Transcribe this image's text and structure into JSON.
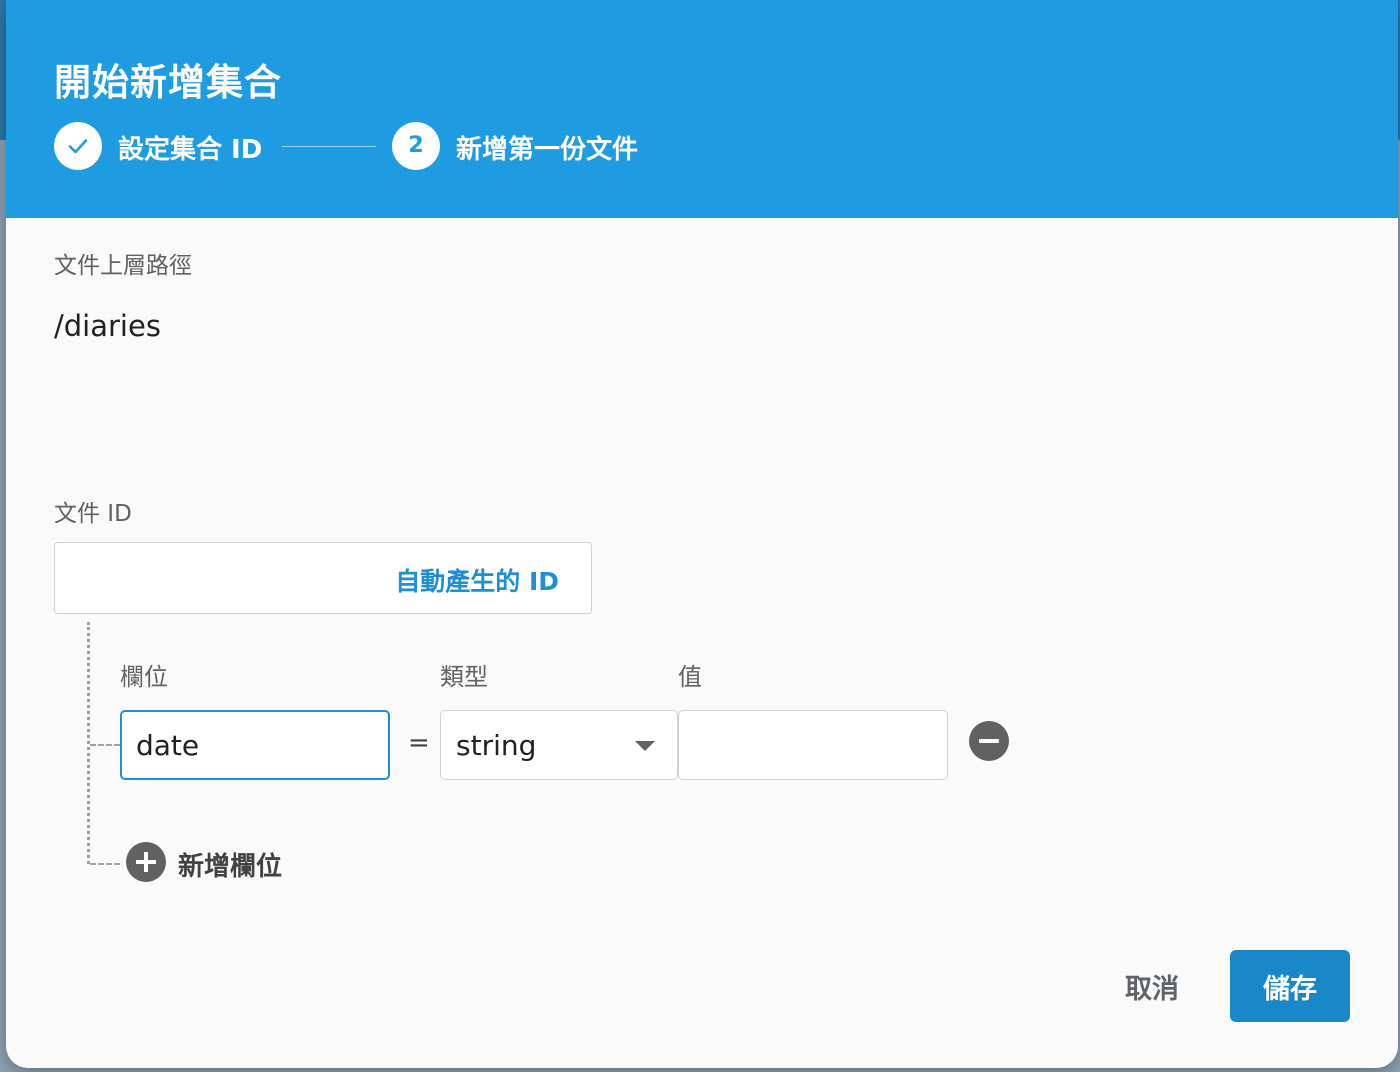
{
  "dialog": {
    "title": "開始新增集合",
    "steps": [
      {
        "number": "1",
        "label": "設定集合 ID",
        "state": "completed",
        "icon": "check-icon"
      },
      {
        "number": "2",
        "label": "新增第一份文件",
        "state": "active"
      }
    ]
  },
  "document": {
    "parent_path_label": "文件上層路徑",
    "parent_path_value": "/diaries",
    "id_label": "文件 ID",
    "auto_id_button": "自動產生的 ID"
  },
  "fields": {
    "column_labels": {
      "field": "欄位",
      "type": "類型",
      "value": "值"
    },
    "rows": [
      {
        "field": "date",
        "equals": "=",
        "type": "string",
        "value": ""
      }
    ],
    "add_field_label": "新增欄位"
  },
  "footer": {
    "cancel_label": "取消",
    "save_label": "儲存"
  },
  "colors": {
    "header_bg": "#1e9be1",
    "accent": "#1e8ed6",
    "primary_button": "#1a87c8",
    "icon_gray": "#616161"
  }
}
